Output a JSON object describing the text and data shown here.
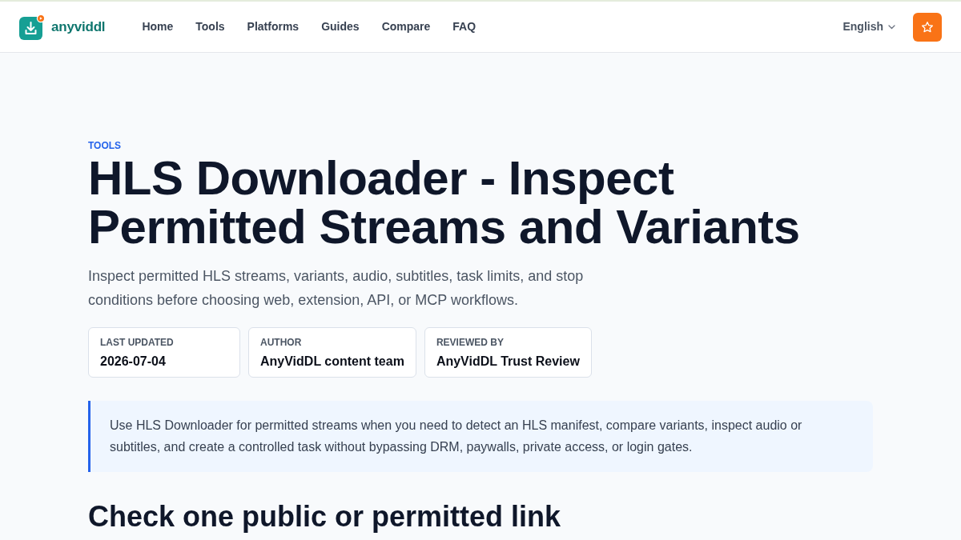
{
  "header": {
    "logo": {
      "text": "anyviddl"
    },
    "nav": [
      {
        "label": "Home"
      },
      {
        "label": "Tools"
      },
      {
        "label": "Platforms"
      },
      {
        "label": "Guides"
      },
      {
        "label": "Compare"
      },
      {
        "label": "FAQ"
      }
    ],
    "language": {
      "label": "English"
    }
  },
  "hero": {
    "eyebrow": "TOOLS",
    "title": "HLS Downloader - Inspect Permitted Streams and Variants",
    "subtitle": "Inspect permitted HLS streams, variants, audio, subtitles, task limits, and stop conditions before choosing web, extension, API, or MCP workflows.",
    "meta": [
      {
        "label": "LAST UPDATED",
        "value": "2026-07-04"
      },
      {
        "label": "AUTHOR",
        "value": "AnyVidDL content team"
      },
      {
        "label": "REVIEWED BY",
        "value": "AnyVidDL Trust Review"
      }
    ]
  },
  "callout": {
    "text": "Use HLS Downloader for permitted streams when you need to detect an HLS manifest, compare variants, inspect audio or subtitles, and create a controlled task without bypassing DRM, paywalls, private access, or login gates."
  },
  "section": {
    "heading": "Check one public or permitted link"
  }
}
